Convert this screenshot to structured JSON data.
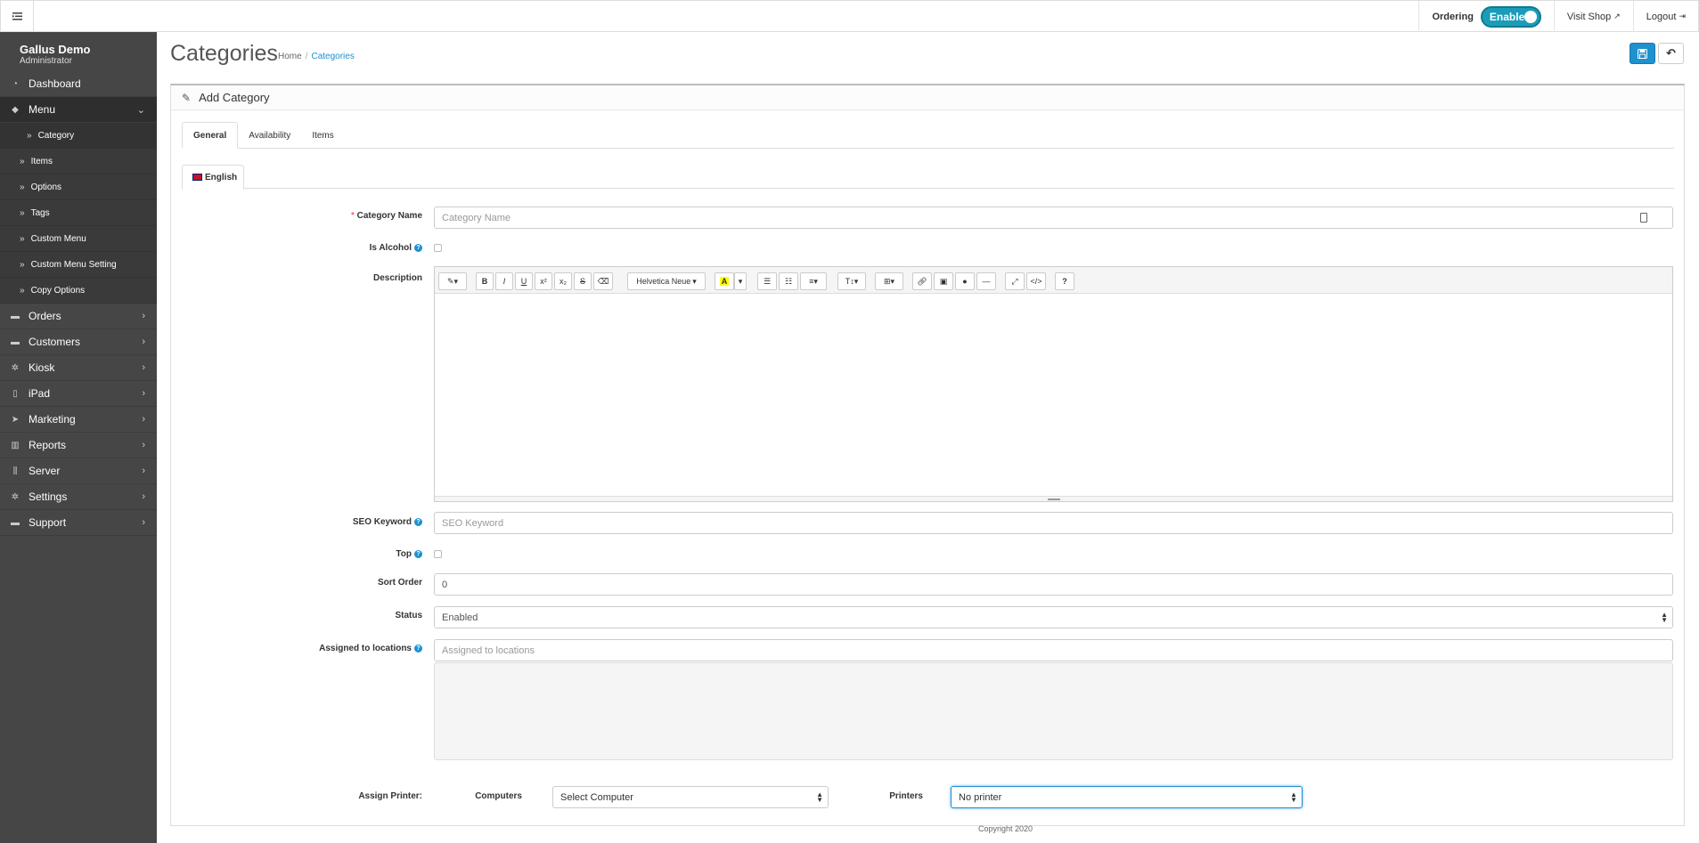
{
  "topbar": {
    "ordering_label": "Ordering",
    "ordering_toggle": "Enable",
    "visit_shop": "Visit Shop",
    "logout": "Logout"
  },
  "sidebar": {
    "brand_name": "Gallus Demo",
    "brand_role": "Administrator",
    "dashboard": "Dashboard",
    "menu": "Menu",
    "menu_sub": [
      "Category",
      "Items",
      "Options",
      "Tags",
      "Custom Menu",
      "Custom Menu Setting",
      "Copy Options"
    ],
    "items": [
      "Orders",
      "Customers",
      "Kiosk",
      "iPad",
      "Marketing",
      "Reports",
      "Server",
      "Settings",
      "Support"
    ]
  },
  "header": {
    "title": "Categories",
    "breadcrumb_home": "Home",
    "breadcrumb_current": "Categories"
  },
  "panel": {
    "title": "Add Category",
    "tabs": [
      "General",
      "Availability",
      "Items"
    ],
    "language_tab": "English"
  },
  "form": {
    "category_name_label": "Category Name",
    "category_name_placeholder": "Category Name",
    "is_alcohol_label": "Is Alcohol",
    "description_label": "Description",
    "font_name": "Helvetica Neue",
    "seo_keyword_label": "SEO Keyword",
    "seo_keyword_placeholder": "SEO Keyword",
    "top_label": "Top",
    "sort_order_label": "Sort Order",
    "sort_order_value": "0",
    "status_label": "Status",
    "status_value": "Enabled",
    "locations_label": "Assigned to locations",
    "locations_placeholder": "Assigned to locations",
    "assign_printer_label": "Assign Printer:",
    "computers_label": "Computers",
    "computers_value": "Select Computer",
    "printers_label": "Printers",
    "printers_value": "No printer"
  },
  "footer": {
    "copyright": "Copyright 2020"
  },
  "colors": {
    "accent": "#1e91cf",
    "sidebar": "#464646",
    "toggle": "#1a9db8"
  }
}
